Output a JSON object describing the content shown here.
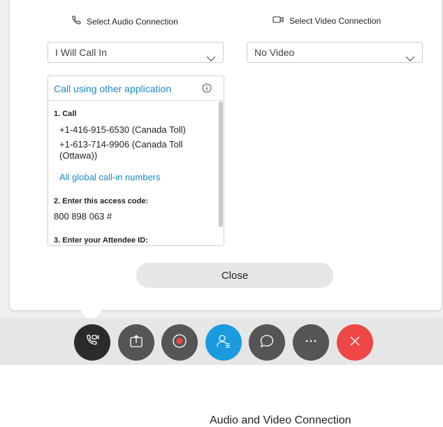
{
  "panel": {
    "audio_heading": "Select Audio Connection",
    "video_heading": "Select Video Connection",
    "audio_select_value": "I Will Call In",
    "video_select_value": "No Video",
    "call_other_app_link": "Call using other application",
    "step1_label": "1. Call",
    "phone1": "+1-416-915-6530 (Canada Toll)",
    "phone2": "+1-613-714-9906 (Canada Toll (Ottawa))",
    "global_numbers_link": "All global call-in numbers",
    "step2_label": "2. Enter this access code:",
    "access_code": "800 898 063 #",
    "step3_label": "3. Enter your Attendee ID:",
    "close_label": "Close"
  },
  "toolbar": {
    "buttons": [
      {
        "name": "audio-connection",
        "icon": "phone-video-icon",
        "color": "#2b2b2b"
      },
      {
        "name": "share",
        "icon": "share-upload-icon",
        "color": "#555555"
      },
      {
        "name": "record",
        "icon": "record-icon",
        "color": "#555555"
      },
      {
        "name": "participants",
        "icon": "participants-icon",
        "color": "#1a9be0"
      },
      {
        "name": "chat",
        "icon": "chat-bubble-icon",
        "color": "#555555"
      },
      {
        "name": "more",
        "icon": "more-ellipsis-icon",
        "color": "#555555"
      },
      {
        "name": "leave",
        "icon": "close-x-icon",
        "color": "#ef4646"
      }
    ]
  },
  "footer_title": "Audio and Video Connection"
}
